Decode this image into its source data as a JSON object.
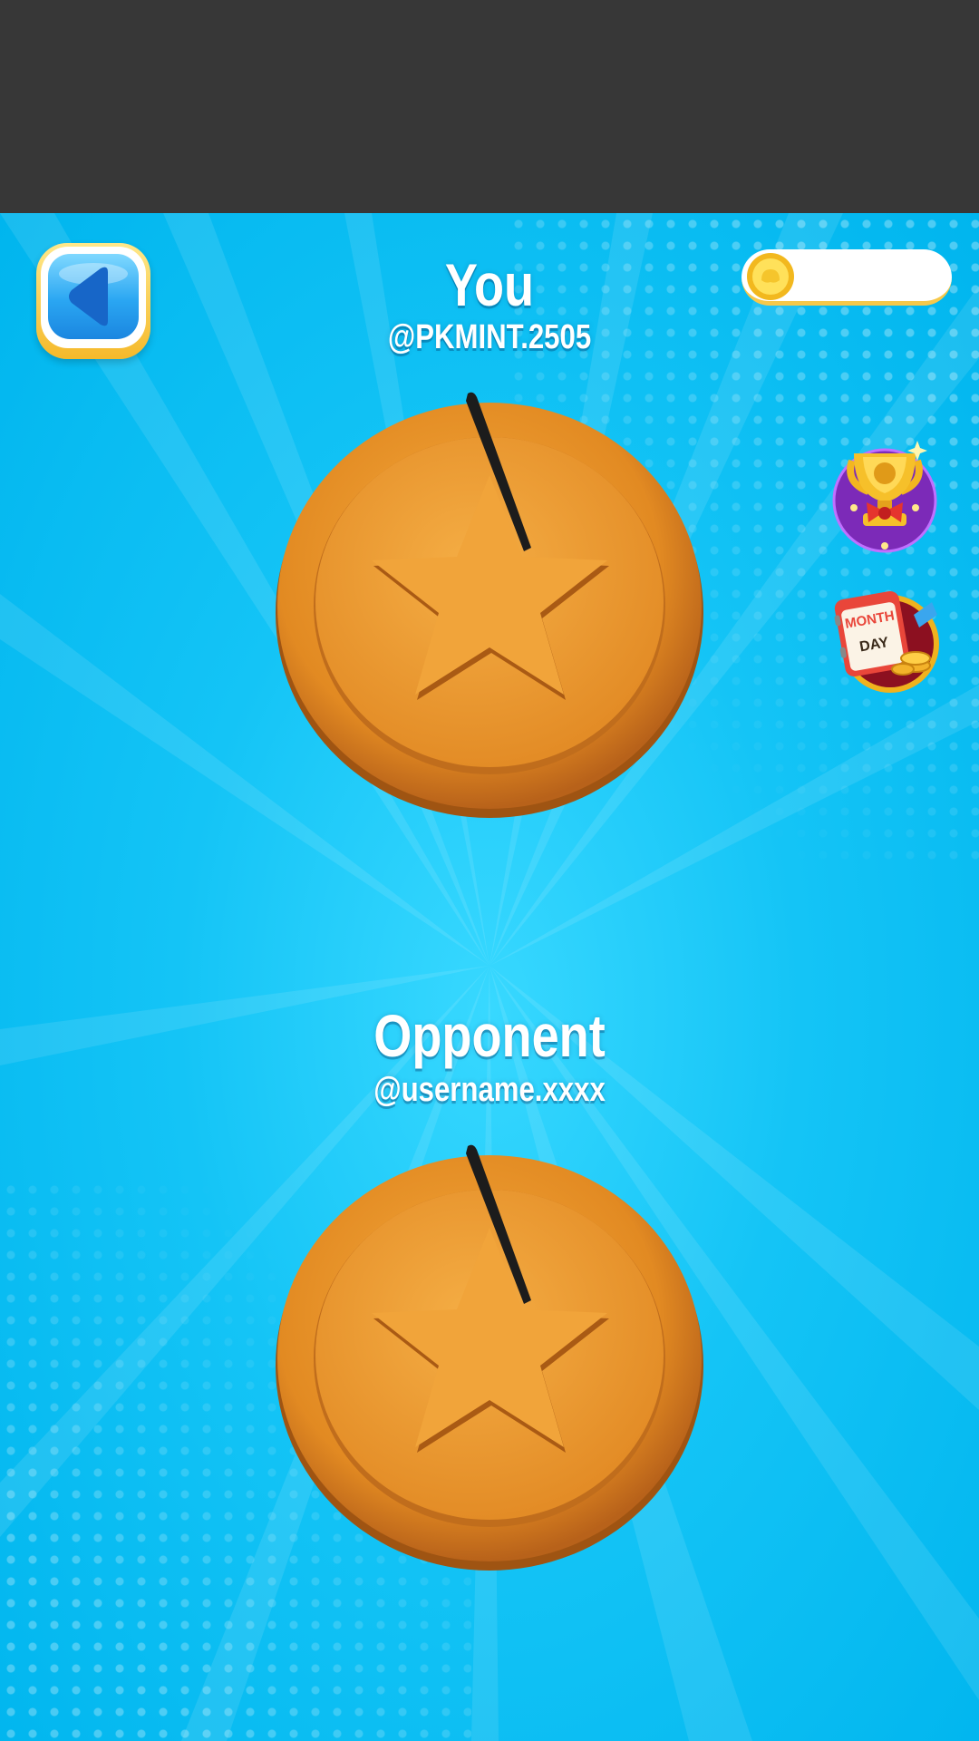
{
  "header": {
    "back_label": ""
  },
  "coins": {
    "value": ""
  },
  "side_buttons": {
    "trophy": "trophy-icon",
    "calendar": "month-day-calendar-icon",
    "calendar_text_top": "MONTH",
    "calendar_text_bottom": "DAY"
  },
  "player": {
    "title": "You",
    "handle": "@PKMINT.2505"
  },
  "opponent": {
    "title": "Opponent",
    "handle": "@username.xxxx"
  },
  "colors": {
    "sky": "#00c8f5",
    "top_bar": "#373737",
    "cookie": "#e8962c",
    "back_button": "#2aa6f2",
    "coin_gold": "#f6c84a"
  }
}
